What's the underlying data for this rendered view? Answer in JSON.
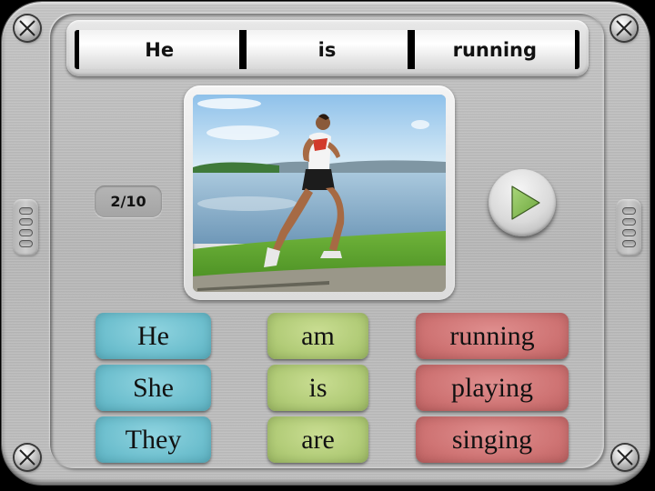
{
  "sentence_slots": [
    "He",
    "is",
    "running"
  ],
  "progress": {
    "current": 2,
    "total": 10,
    "label": "2/10"
  },
  "picture": {
    "description": "man running beside a lake"
  },
  "play_button": {
    "icon": "play-icon",
    "color": "#8fc45a"
  },
  "word_columns": {
    "subjects": {
      "color": "#72c2d0",
      "words": [
        "He",
        "She",
        "They"
      ]
    },
    "verbs": {
      "color": "#b3cc7a",
      "words": [
        "am",
        "is",
        "are"
      ]
    },
    "actions": {
      "color": "#d07878",
      "words": [
        "running",
        "playing",
        "singing"
      ]
    }
  },
  "decor": {
    "screw_icon": "screw-icon",
    "grip_icon": "side-grip-icon"
  }
}
